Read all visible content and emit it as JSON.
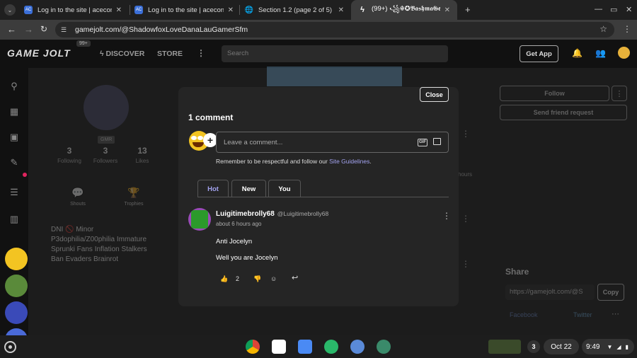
{
  "browser": {
    "tabs": [
      {
        "title": "Log in to the site | aceconnect",
        "favicon": "AC"
      },
      {
        "title": "Log in to the site | aceconnect",
        "favicon": "AC"
      },
      {
        "title": "Section 1.2 (page 2 of 5) | aceconn",
        "favicon": "globe"
      },
      {
        "title": "(99+) ꧁☬✪𝕭𝖆𝖘𝖍𝖒𝖆𝕲𝖊𝖆𝖗",
        "favicon": "gamejolt"
      }
    ],
    "active_tab": 3,
    "url": "gamejolt.com/@ShadowfoxLoveDanaLauGamerSfm"
  },
  "nav": {
    "logo": "GAME JOLT",
    "logo_badge": "99+",
    "discover": "DISCOVER",
    "store": "STORE",
    "search_placeholder": "Search",
    "get_app": "Get App"
  },
  "profile": {
    "badge": "GMR",
    "stats": [
      {
        "value": "3",
        "label": "Following"
      },
      {
        "value": "3",
        "label": "Followers"
      },
      {
        "value": "13",
        "label": "Likes"
      }
    ],
    "shortcuts": [
      "Shouts",
      "Trophies"
    ],
    "bio": [
      "DNI 🚫 Minor",
      "P3dophilia/Z00philia Immature",
      "Sprunki Fans Inflation Stalkers",
      "Ban Evaders Brainrot"
    ],
    "follow": "Follow",
    "friend_request": "Send friend request",
    "share_title": "Share",
    "share_url": "https://gamejolt.com/@S",
    "copy": "Copy",
    "facebook": "Facebook",
    "twitter": "Twitter",
    "hours": "hours"
  },
  "modal": {
    "close": "Close",
    "title": "1 comment",
    "input_placeholder": "Leave a comment...",
    "gif": "GIF",
    "guidelines_prefix": "Remember to be respectful and follow our ",
    "guidelines_link": "Site Guidelines",
    "guidelines_suffix": ".",
    "tabs": [
      "Hot",
      "New",
      "You"
    ],
    "comment": {
      "user": "Luigitimebrolly68",
      "handle": "@Luigitimebrolly68",
      "time": "about 6 hours ago",
      "line1": "Anti Jocelyn",
      "line2": "Well you  are Jocelyn",
      "likes": "2"
    }
  },
  "taskbar": {
    "badge": "3",
    "date": "Oct 22",
    "time": "9:49"
  },
  "colors": {
    "accent": "#a3a3f0",
    "modal_bg": "#252525",
    "page_bg": "#1c1c1c"
  }
}
